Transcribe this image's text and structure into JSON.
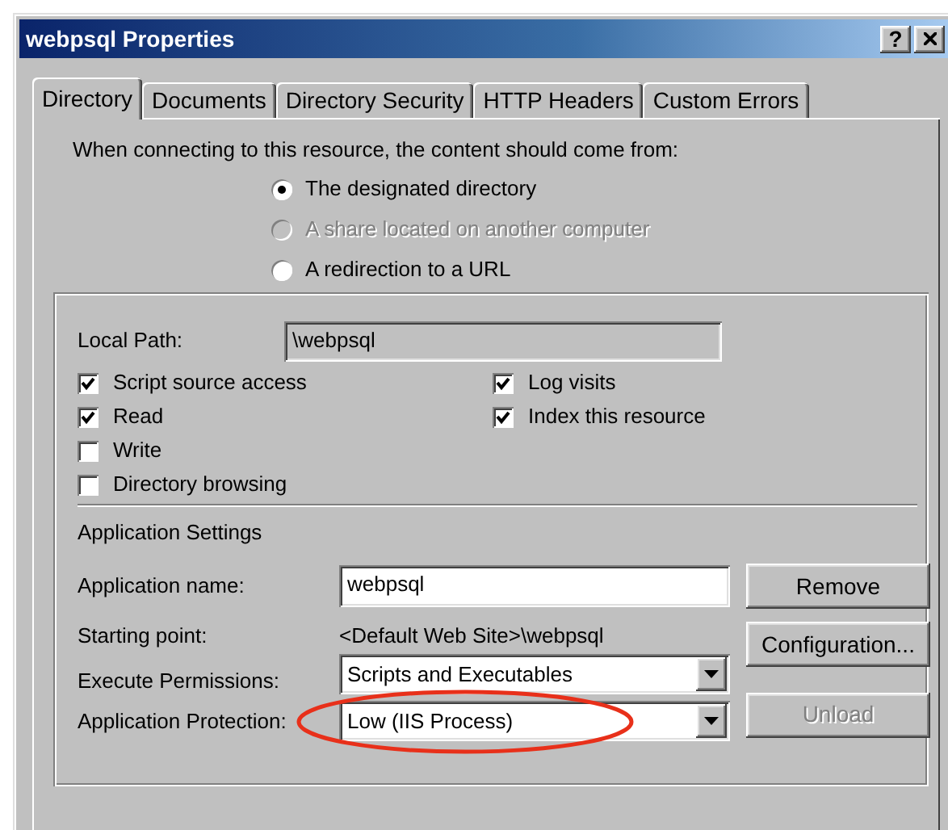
{
  "window": {
    "title": "webpsql Properties",
    "help": "?"
  },
  "tabs": [
    {
      "label": "Directory",
      "selected": true
    },
    {
      "label": "Documents",
      "selected": false
    },
    {
      "label": "Directory Security",
      "selected": false
    },
    {
      "label": "HTTP Headers",
      "selected": false
    },
    {
      "label": "Custom Errors",
      "selected": false
    }
  ],
  "content_source": {
    "prompt": "When connecting to this resource, the content should come from:",
    "options": [
      {
        "label": "The designated directory",
        "selected": true,
        "disabled": false
      },
      {
        "label": "A share located on another computer",
        "selected": false,
        "disabled": true
      },
      {
        "label": "A redirection to a URL",
        "selected": false,
        "disabled": false
      }
    ]
  },
  "local_path": {
    "label": "Local Path:",
    "value": "\\webpsql"
  },
  "access_options": [
    {
      "label": "Script source access",
      "checked": true
    },
    {
      "label": "Read",
      "checked": true
    },
    {
      "label": "Write",
      "checked": false
    },
    {
      "label": "Directory browsing",
      "checked": false
    }
  ],
  "logging_options": [
    {
      "label": "Log visits",
      "checked": true
    },
    {
      "label": "Index this resource",
      "checked": true
    }
  ],
  "application_settings": {
    "heading": "Application Settings",
    "name": {
      "label": "Application name:",
      "value": "webpsql"
    },
    "starting_point": {
      "label": "Starting point:",
      "value": "<Default Web Site>\\webpsql"
    },
    "execute_permissions": {
      "label": "Execute Permissions:",
      "value": "Scripts and Executables"
    },
    "protection": {
      "label": "Application Protection:",
      "value": "Low (IIS Process)",
      "highlighted": true
    },
    "buttons": [
      {
        "label": "Remove",
        "disabled": false
      },
      {
        "label": "Configuration...",
        "disabled": false
      },
      {
        "label": "Unload",
        "disabled": true
      }
    ]
  }
}
